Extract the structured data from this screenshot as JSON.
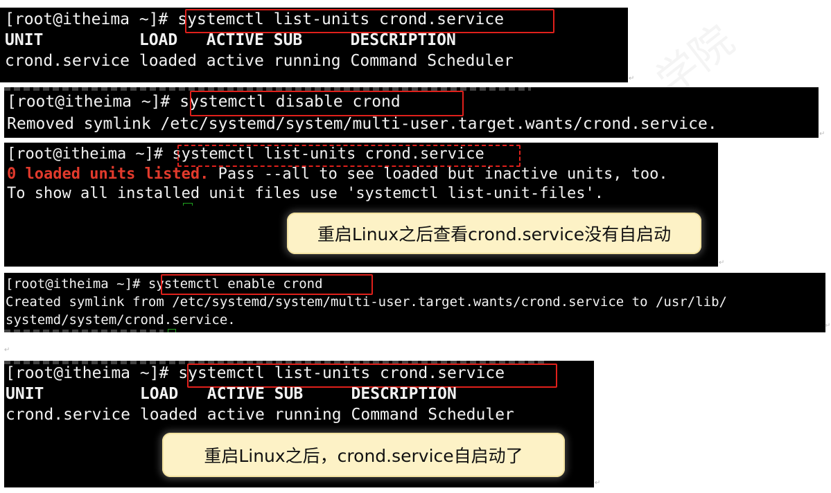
{
  "prompt": "[root@itheima ~]# ",
  "blocks": [
    {
      "command": "systemctl list-units crond.service",
      "output": [
        "UNIT          LOAD   ACTIVE SUB     DESCRIPTION",
        "crond.service loaded active running Command Scheduler"
      ]
    },
    {
      "command": "systemctl disable crond",
      "output": [
        "Removed symlink /etc/systemd/system/multi-user.target.wants/crond.service."
      ]
    },
    {
      "command": "systemctl list-units crond.service",
      "output_red": "0 loaded units listed.",
      "output_rest": " Pass --all to see loaded but inactive units, too.",
      "output2": "To show all installed unit files use 'systemctl list-unit-files'.",
      "callout": "重启Linux之后查看crond.service没有自启动"
    },
    {
      "command": "systemctl enable crond",
      "output": [
        "Created symlink from /etc/systemd/system/multi-user.target.wants/crond.service to /usr/lib/",
        "systemd/system/crond.service."
      ]
    },
    {
      "command": "systemctl list-units crond.service",
      "output": [
        "UNIT          LOAD   ACTIVE SUB     DESCRIPTION",
        "crond.service loaded active running Command Scheduler"
      ],
      "callout": "重启Linux之后，crond.service自启动了"
    }
  ],
  "paragraph_mark": "↵"
}
